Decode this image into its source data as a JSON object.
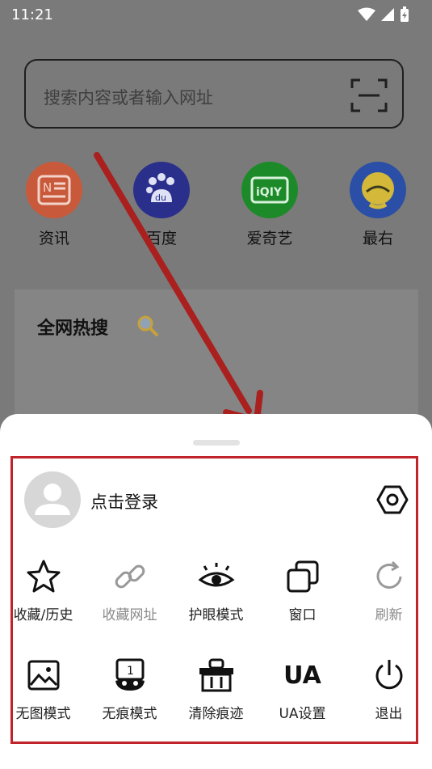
{
  "status_bar": {
    "time": "11:21"
  },
  "search": {
    "placeholder": "搜索内容或者输入网址"
  },
  "shortcuts": [
    {
      "label": "资讯",
      "icon": "news-icon",
      "color": "#d85d3f"
    },
    {
      "label": "百度",
      "icon": "baidu-paw-icon",
      "color": "#2d38a8"
    },
    {
      "label": "爱奇艺",
      "icon": "iqiyi-icon",
      "color": "#1a9f2c"
    },
    {
      "label": "最右",
      "icon": "zuiyou-icon",
      "color": "#2f55b8"
    }
  ],
  "hot_search": {
    "title": "全网热搜"
  },
  "sheet": {
    "login_label": "点击登录",
    "row1": [
      {
        "label": "收藏/历史",
        "icon": "star-icon",
        "enabled": true
      },
      {
        "label": "收藏网址",
        "icon": "link-icon",
        "enabled": false
      },
      {
        "label": "护眼模式",
        "icon": "eye-icon",
        "enabled": true
      },
      {
        "label": "窗口",
        "icon": "windows-icon",
        "enabled": true
      },
      {
        "label": "刷新",
        "icon": "refresh-icon",
        "enabled": false
      }
    ],
    "row2": [
      {
        "label": "无图模式",
        "icon": "image-icon",
        "enabled": true
      },
      {
        "label": "无痕模式",
        "icon": "incognito-mask-icon",
        "enabled": true
      },
      {
        "label": "清除痕迹",
        "icon": "clear-basket-icon",
        "enabled": true
      },
      {
        "label": "UA设置",
        "icon": "ua-icon",
        "enabled": true
      },
      {
        "label": "退出",
        "icon": "power-icon",
        "enabled": true
      }
    ],
    "ua_text": "UA",
    "badge_number": "1"
  },
  "colors": {
    "annotation_red": "#c1232b",
    "overlay": "#7a7a7a"
  }
}
